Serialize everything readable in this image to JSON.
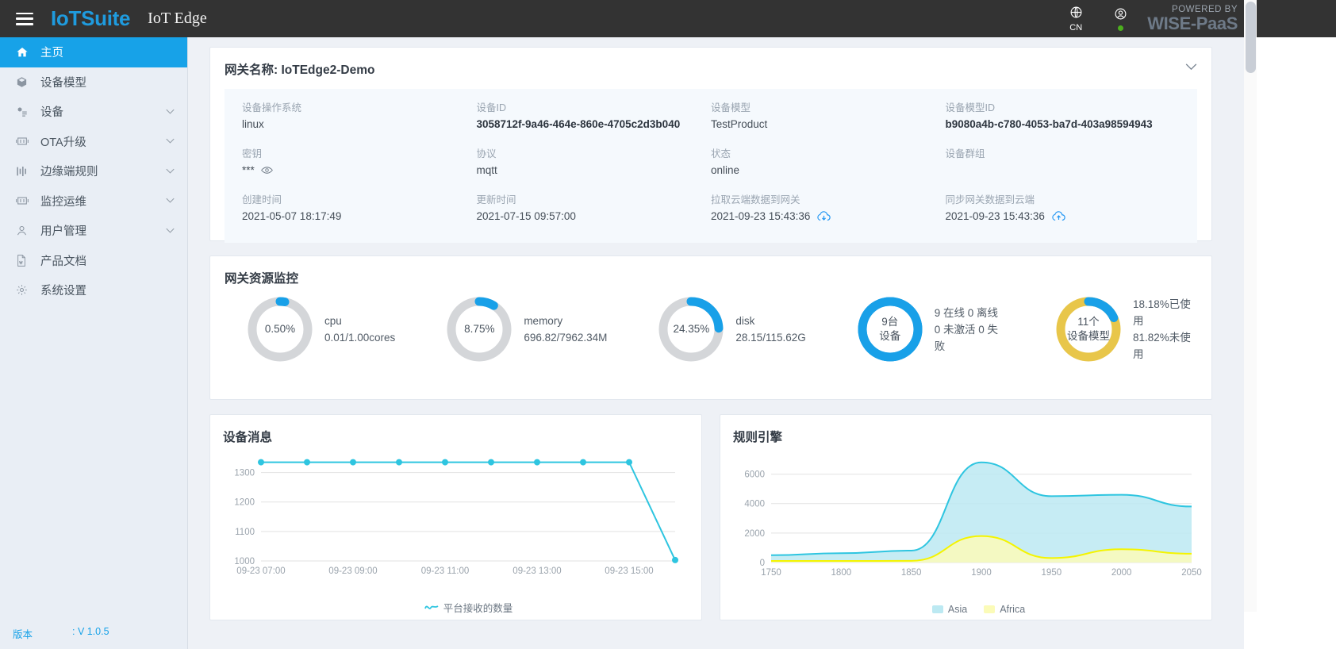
{
  "header": {
    "menu_icon": "hamburger-icon",
    "brand": "IoTSuite",
    "subtitle": "IoT Edge",
    "lang_icon": "globe-icon",
    "lang_label": "CN",
    "user_icon": "user-icon",
    "powered_line1": "POWERED BY",
    "powered_line2": "WISE-PaaS",
    "brand_color": "#1f9bde",
    "bar_color": "#333333",
    "status_color": "#4caf1e"
  },
  "sidebar": {
    "items": [
      {
        "label": "主页",
        "icon": "home-icon",
        "active": true,
        "expandable": false
      },
      {
        "label": "设备模型",
        "icon": "cube-icon",
        "active": false,
        "expandable": false
      },
      {
        "label": "设备",
        "icon": "devices-icon",
        "active": false,
        "expandable": true
      },
      {
        "label": "OTA升级",
        "icon": "chip-icon",
        "active": false,
        "expandable": true
      },
      {
        "label": "边缘端规则",
        "icon": "sliders-icon",
        "active": false,
        "expandable": true
      },
      {
        "label": "监控运维",
        "icon": "chip-icon",
        "active": false,
        "expandable": true
      },
      {
        "label": "用户管理",
        "icon": "user-icon",
        "active": false,
        "expandable": true
      },
      {
        "label": "产品文档",
        "icon": "doc-icon",
        "active": false,
        "expandable": false
      },
      {
        "label": "系统设置",
        "icon": "gear-icon",
        "active": false,
        "expandable": false
      }
    ],
    "version_label": "版本",
    "version_value": ": V 1.0.5",
    "accent": "#17a2e8"
  },
  "gateway": {
    "title_prefix": "网关名称: ",
    "name": "IoTEdge2-Demo",
    "collapse_icon": "chevron-down-icon",
    "fields": [
      {
        "key": "设备操作系统",
        "value": "linux",
        "bold": false,
        "icon": ""
      },
      {
        "key": "设备ID",
        "value": "3058712f-9a46-464e-860e-4705c2d3b040",
        "bold": true,
        "icon": ""
      },
      {
        "key": "设备模型",
        "value": "TestProduct",
        "bold": false,
        "icon": ""
      },
      {
        "key": "设备模型ID",
        "value": "b9080a4b-c780-4053-ba7d-403a98594943",
        "bold": true,
        "icon": ""
      },
      {
        "key": "密钥",
        "value": "***",
        "bold": false,
        "icon": "eye-icon"
      },
      {
        "key": "协议",
        "value": "mqtt",
        "bold": false,
        "icon": ""
      },
      {
        "key": "状态",
        "value": "online",
        "bold": false,
        "icon": ""
      },
      {
        "key": "设备群组",
        "value": "",
        "bold": false,
        "icon": ""
      },
      {
        "key": "创建时间",
        "value": "2021-05-07 18:17:49",
        "bold": false,
        "icon": ""
      },
      {
        "key": "更新时间",
        "value": "2021-07-15 09:57:00",
        "bold": false,
        "icon": ""
      },
      {
        "key": "拉取云端数据到网关",
        "value": "2021-09-23 15:43:36",
        "bold": false,
        "icon": "cloud-download-icon"
      },
      {
        "key": "同步网关数据到云端",
        "value": "2021-09-23 15:43:36",
        "bold": false,
        "icon": "cloud-upload-icon"
      }
    ]
  },
  "resources": {
    "title": "网关资源监控",
    "gauges": [
      {
        "center": "0.50%",
        "center2": "",
        "name": "cpu",
        "detail": "0.01/1.00cores",
        "percent": 0.5,
        "color": "#18a0e8",
        "track": "#d4d6d9"
      },
      {
        "center": "8.75%",
        "center2": "",
        "name": "memory",
        "detail": "696.82/7962.34M",
        "percent": 8.75,
        "color": "#18a0e8",
        "track": "#d4d6d9"
      },
      {
        "center": "24.35%",
        "center2": "",
        "name": "disk",
        "detail": "28.15/115.62G",
        "percent": 24.35,
        "color": "#18a0e8",
        "track": "#d4d6d9"
      },
      {
        "center": "9台",
        "center2": "设备",
        "name": "9 在线 0 离线",
        "detail": "0 未激活 0 失败",
        "percent": 100,
        "color": "#18a0e8",
        "track": "#18a0e8"
      },
      {
        "center": "11个",
        "center2": "设备模型",
        "name": "18.18%已使用",
        "detail": "81.82%未使用",
        "percent": 18.18,
        "color": "#18a0e8",
        "track": "#e8c64a"
      }
    ]
  },
  "device_message": {
    "title": "设备消息"
  },
  "rule_engine": {
    "title": "规则引擎"
  },
  "chart_data": [
    {
      "type": "line",
      "title": "设备消息",
      "xlabel": "",
      "ylabel": "",
      "ylim": [
        1000,
        1350
      ],
      "yticks": [
        1000,
        1100,
        1200,
        1300
      ],
      "xticks": [
        "09-23 07:00",
        "09-23 09:00",
        "09-23 11:00",
        "09-23 13:00",
        "09-23 15:00"
      ],
      "grid": true,
      "legend": [
        "平台接收的数量"
      ],
      "legend_position": "bottom",
      "series": [
        {
          "name": "平台接收的数量",
          "color": "#2ec5e0",
          "x": [
            "09-23 07:00",
            "09-23 08:00",
            "09-23 09:00",
            "09-23 10:00",
            "09-23 11:00",
            "09-23 12:00",
            "09-23 13:00",
            "09-23 14:00",
            "09-23 15:00",
            "09-23 16:00"
          ],
          "values": [
            1335,
            1335,
            1335,
            1335,
            1335,
            1335,
            1335,
            1335,
            1335,
            1003
          ]
        }
      ]
    },
    {
      "type": "area",
      "title": "规则引擎",
      "xlabel": "",
      "ylabel": "",
      "ylim": [
        0,
        7000
      ],
      "yticks": [
        0,
        2000,
        4000,
        6000
      ],
      "xticks": [
        1750,
        1800,
        1850,
        1900,
        1950,
        2000,
        2050
      ],
      "grid": true,
      "legend": [
        "Asia",
        "Africa"
      ],
      "legend_position": "bottom",
      "x": [
        1750,
        1800,
        1850,
        1900,
        1950,
        2000,
        2050
      ],
      "series": [
        {
          "name": "Asia",
          "color": "#2ec5e0",
          "fill": "#bce9f2",
          "values": [
            502,
            635,
            809,
            6800,
            4500,
            4600,
            3800
          ]
        },
        {
          "name": "Africa",
          "color": "#f4f400",
          "fill": "#fbfbb8",
          "values": [
            106,
            107,
            111,
            1800,
            300,
            900,
            600
          ]
        }
      ]
    }
  ]
}
